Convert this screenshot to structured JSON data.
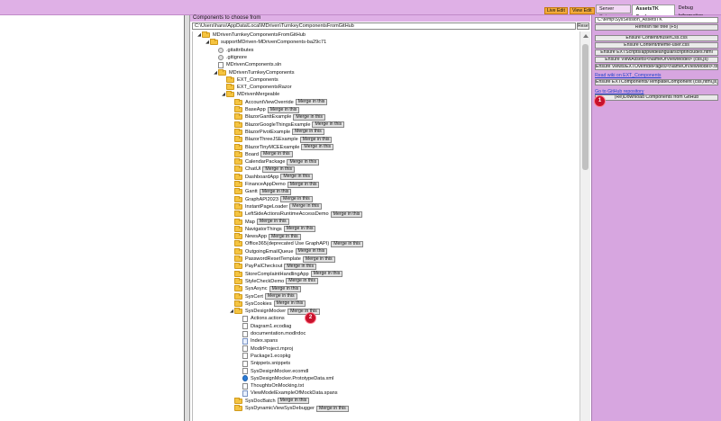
{
  "top_buttons": {
    "live_edit": "Live Edit",
    "view_edit": "View Edit"
  },
  "tabs": [
    "Server Setup",
    "AssetsTK Synk",
    "Debug Information"
  ],
  "center": {
    "heading": "Components to choose from",
    "path": "C:\\Users\\hans\\AppData\\Local\\MDriven\\TurnkeyComponentsFromGitHub",
    "reset_label": "Reset"
  },
  "tree": [
    {
      "level": 0,
      "toggle": "◢",
      "icon": "folder",
      "label": "MDrivenTurnkeyComponentsFromGitHub"
    },
    {
      "level": 1,
      "toggle": "◢",
      "icon": "folder",
      "label": "supportMDriven-MDrivenComponents-ba29c71"
    },
    {
      "level": 2,
      "toggle": "",
      "icon": "gear",
      "label": ".gitattributes"
    },
    {
      "level": 2,
      "toggle": "",
      "icon": "gear",
      "label": ".gitignore"
    },
    {
      "level": 2,
      "toggle": "",
      "icon": "file",
      "label": "MDrivenComponents.sln"
    },
    {
      "level": 2,
      "toggle": "◢",
      "icon": "folder",
      "label": "MDrivenTurnkeyComponents"
    },
    {
      "level": 3,
      "toggle": "",
      "icon": "folder",
      "label": "EXT_Components"
    },
    {
      "level": 3,
      "toggle": "",
      "icon": "folder",
      "label": "EXT_ComponentsRazor"
    },
    {
      "level": 3,
      "toggle": "◢",
      "icon": "folder",
      "label": "MDrivenMergeable"
    },
    {
      "level": 4,
      "toggle": "",
      "icon": "folder",
      "label": "AccountViewOverride",
      "merge": "Merge in this"
    },
    {
      "level": 4,
      "toggle": "",
      "icon": "folder",
      "label": "BaseApp",
      "merge": "Merge in this"
    },
    {
      "level": 4,
      "toggle": "",
      "icon": "folder",
      "label": "BlazorGanttExample",
      "merge": "Merge in this"
    },
    {
      "level": 4,
      "toggle": "",
      "icon": "folder",
      "label": "BlazorGoogleThingsExample",
      "merge": "Merge in this"
    },
    {
      "level": 4,
      "toggle": "",
      "icon": "folder",
      "label": "BlazorPivotExample",
      "merge": "Merge in this"
    },
    {
      "level": 4,
      "toggle": "",
      "icon": "folder",
      "label": "BlazorThreeJSExample",
      "merge": "Merge in this"
    },
    {
      "level": 4,
      "toggle": "",
      "icon": "folder",
      "label": "BlazorTinyMCEExample",
      "merge": "Merge in this"
    },
    {
      "level": 4,
      "toggle": "",
      "icon": "folder",
      "label": "Board",
      "merge": "Merge in this"
    },
    {
      "level": 4,
      "toggle": "",
      "icon": "folder",
      "label": "CalendarPackage",
      "merge": "Merge in this"
    },
    {
      "level": 4,
      "toggle": "",
      "icon": "folder",
      "label": "ChatUI",
      "merge": "Merge in this"
    },
    {
      "level": 4,
      "toggle": "",
      "icon": "folder",
      "label": "DashboardApp",
      "merge": "Merge in this"
    },
    {
      "level": 4,
      "toggle": "",
      "icon": "folder",
      "label": "FinanceAppDemo",
      "merge": "Merge in this"
    },
    {
      "level": 4,
      "toggle": "",
      "icon": "folder",
      "label": "Gantt",
      "merge": "Merge in this"
    },
    {
      "level": 4,
      "toggle": "",
      "icon": "folder",
      "label": "GraphAPI2023",
      "merge": "Merge in this"
    },
    {
      "level": 4,
      "toggle": "",
      "icon": "folder",
      "label": "InstantPageLoader",
      "merge": "Merge in this"
    },
    {
      "level": 4,
      "toggle": "",
      "icon": "folder",
      "label": "LeftSideActionsRuntimeAccessDemo",
      "merge": "Merge in this"
    },
    {
      "level": 4,
      "toggle": "",
      "icon": "folder",
      "label": "Map",
      "merge": "Merge in this"
    },
    {
      "level": 4,
      "toggle": "",
      "icon": "folder",
      "label": "NavigatorThings",
      "merge": "Merge in this"
    },
    {
      "level": 4,
      "toggle": "",
      "icon": "folder",
      "label": "NewsApp",
      "merge": "Merge in this"
    },
    {
      "level": 4,
      "toggle": "",
      "icon": "folder",
      "label": "Office365(deprecated Use GraphAPI)",
      "merge": "Merge in this"
    },
    {
      "level": 4,
      "toggle": "",
      "icon": "folder",
      "label": "OutgoingEmailQueue",
      "merge": "Merge in this"
    },
    {
      "level": 4,
      "toggle": "",
      "icon": "folder",
      "label": "PasswordResetTemplate",
      "merge": "Merge in this"
    },
    {
      "level": 4,
      "toggle": "",
      "icon": "folder",
      "label": "PayPalCheckout",
      "merge": "Merge in this"
    },
    {
      "level": 4,
      "toggle": "",
      "icon": "folder",
      "label": "StoreComplaintHandlingApp",
      "merge": "Merge in this"
    },
    {
      "level": 4,
      "toggle": "",
      "icon": "folder",
      "label": "StyleCheckDemo",
      "merge": "Merge in this"
    },
    {
      "level": 4,
      "toggle": "",
      "icon": "folder",
      "label": "SysAsync",
      "merge": "Merge in this"
    },
    {
      "level": 4,
      "toggle": "",
      "icon": "folder",
      "label": "SysCert",
      "merge": "Merge in this"
    },
    {
      "level": 4,
      "toggle": "",
      "icon": "folder",
      "label": "SysCookies",
      "merge": "Merge in this"
    },
    {
      "level": 4,
      "toggle": "◢",
      "icon": "folder",
      "label": "SysDesignMocker",
      "merge": "Merge in this"
    },
    {
      "level": 5,
      "toggle": "",
      "icon": "file",
      "label": "Actions.actions"
    },
    {
      "level": 5,
      "toggle": "",
      "icon": "file",
      "label": "Diagram1.ecodiag"
    },
    {
      "level": 5,
      "toggle": "",
      "icon": "file",
      "label": "documentation.modlrdoc"
    },
    {
      "level": 5,
      "toggle": "",
      "icon": "img",
      "label": "Index.spans"
    },
    {
      "level": 5,
      "toggle": "",
      "icon": "file",
      "label": "ModlrProject.mproj"
    },
    {
      "level": 5,
      "toggle": "",
      "icon": "file",
      "label": "Package1.ecopkg"
    },
    {
      "level": 5,
      "toggle": "",
      "icon": "file",
      "label": "Snippets.snippets"
    },
    {
      "level": 5,
      "toggle": "",
      "icon": "file",
      "label": "SysDesignMocker.ecomdl"
    },
    {
      "level": 5,
      "toggle": "",
      "icon": "edge",
      "label": "SysDesignMocker.PrototypeData.xml"
    },
    {
      "level": 5,
      "toggle": "",
      "icon": "file",
      "label": "ThoughtsOnMocking.txt"
    },
    {
      "level": 5,
      "toggle": "",
      "icon": "img",
      "label": "ViewModelExampleOfMockData.spans"
    },
    {
      "level": 4,
      "toggle": "",
      "icon": "folder",
      "label": "SysDocBatch",
      "merge": "Merge in this"
    },
    {
      "level": 4,
      "toggle": "",
      "icon": "folder",
      "label": "SysDynamicViewSysDebugger",
      "merge": "Merge in this"
    }
  ],
  "right_panel": {
    "session_path": "C:\\temp\\SysSession_AssetsTK",
    "refresh": "Refresh file tree (F5)",
    "buttons": [
      "Ensure Content/fluserCss.css",
      "Ensure Content/theme-user.css",
      "Ensure EXTScripts/appwideangularscriptincludes.html",
      "Ensure ViewAssets/<NameOfViewModel> (css,js)",
      "Ensure Views/EXTOverridePages/<NameOfViewModel>.tx"
    ],
    "link_wiki": "Read wiki on EXT_Components",
    "ensure_template": "Ensure EXTComponents/TemplateComponent (css,html,js)",
    "link_github": "Go to GitHub repository",
    "download": "(Re)Download Components from GitHub"
  },
  "badges": [
    "1",
    "2"
  ]
}
